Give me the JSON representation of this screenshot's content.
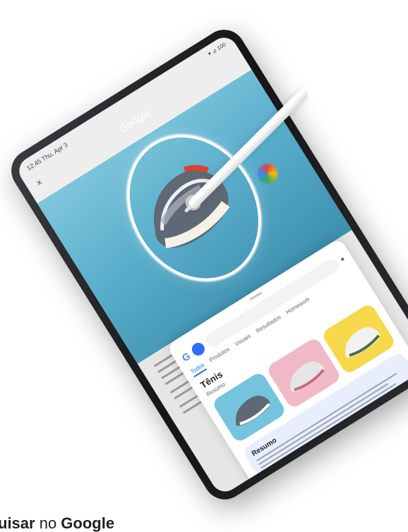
{
  "status": {
    "time": "12:45 Thu, Apr 3",
    "right": "▾ ⊿ 100"
  },
  "app": {
    "title": "Google"
  },
  "results": {
    "tab_active": "Todos",
    "tabs": [
      "Produtos",
      "Visuais",
      "Resultados",
      "Homework"
    ],
    "section_title": "Tênis",
    "section_subtitle": "Resumo",
    "overview_title": "Resumo"
  },
  "caption": {
    "prefix": "uisar",
    "middle": " no ",
    "brand": "Google"
  },
  "colors": {
    "stylus_glow": [
      "#ea4335",
      "#fbbc05",
      "#34a853",
      "#4285f4"
    ]
  }
}
